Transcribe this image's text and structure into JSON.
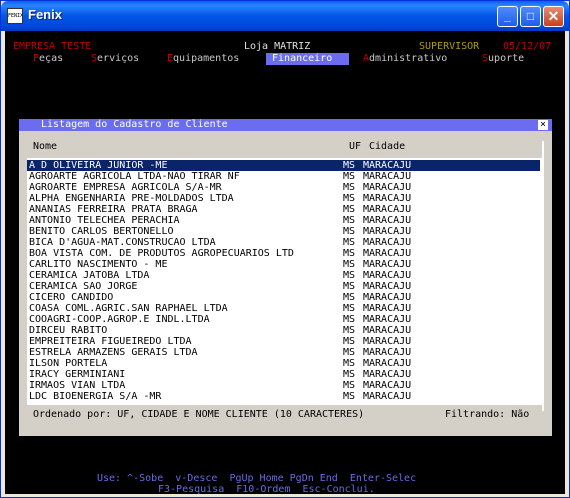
{
  "window": {
    "title": "Fenix",
    "icon_text": "FENIX",
    "btn_min": "_",
    "btn_max": "□",
    "btn_close": "✕"
  },
  "header": {
    "empresa": "EMPRESA TESTE",
    "loja": "Loja MATRIZ",
    "supervisor": "SUPERVISOR",
    "date": "05/12/07"
  },
  "menu": [
    {
      "hotkey": "P",
      "rest": "eças",
      "active": false
    },
    {
      "hotkey": "S",
      "rest": "erviços",
      "active": false
    },
    {
      "hotkey": "E",
      "rest": "quipamentos",
      "active": false
    },
    {
      "hotkey": "F",
      "rest": "inanceiro",
      "active": true
    },
    {
      "hotkey": "A",
      "rest": "dministrativo",
      "active": false
    },
    {
      "hotkey": "S",
      "rest": "uporte",
      "active": false
    }
  ],
  "dialog": {
    "title": "Listagem do Cadastro de Cliente",
    "close": "×",
    "columns": {
      "nome": "Nome",
      "uf": "UF",
      "cidade": "Cidade"
    },
    "rows": [
      {
        "nome": "A D OLIVEIRA JUNIOR -ME",
        "uf": "MS",
        "cidade": "MARACAJU",
        "selected": true
      },
      {
        "nome": "AGROARTE AGRICOLA LTDA-NÃO TIRAR NF",
        "uf": "MS",
        "cidade": "MARACAJU"
      },
      {
        "nome": "AGROARTE EMPRESA AGRICOLA S/A-MR",
        "uf": "MS",
        "cidade": "MARACAJU"
      },
      {
        "nome": "ALPHA ENGENHARIA PRE-MOLDADOS LTDA",
        "uf": "MS",
        "cidade": "MARACAJU"
      },
      {
        "nome": "ANANIAS FERREIRA PRATA BRAGA",
        "uf": "MS",
        "cidade": "MARACAJU"
      },
      {
        "nome": "ANTONIO TELECHEA PERACHIA",
        "uf": "MS",
        "cidade": "MARACAJU"
      },
      {
        "nome": "BENITO CARLOS BERTONELLO",
        "uf": "MS",
        "cidade": "MARACAJU"
      },
      {
        "nome": "BICA D'AGUA-MAT.CONSTRUCAO LTDA",
        "uf": "MS",
        "cidade": "MARACAJU"
      },
      {
        "nome": "BOA VISTA COM. DE PRODUTOS AGROPECUARIOS LTD",
        "uf": "MS",
        "cidade": "MARACAJU"
      },
      {
        "nome": "CARLITO NASCIMENTO - ME",
        "uf": "MS",
        "cidade": "MARACAJU"
      },
      {
        "nome": "CERAMICA JATOBA LTDA",
        "uf": "MS",
        "cidade": "MARACAJU"
      },
      {
        "nome": "CERAMICA SAO JORGE",
        "uf": "MS",
        "cidade": "MARACAJU"
      },
      {
        "nome": "CICERO CANDIDO",
        "uf": "MS",
        "cidade": "MARACAJU"
      },
      {
        "nome": "COASA COML.AGRIC.SAN RAPHAEL LTDA",
        "uf": "MS",
        "cidade": "MARACAJU"
      },
      {
        "nome": "COOAGRI-COOP.AGROP.E INDL.LTDA",
        "uf": "MS",
        "cidade": "MARACAJU"
      },
      {
        "nome": "DIRCEU RABITO",
        "uf": "MS",
        "cidade": "MARACAJU"
      },
      {
        "nome": "EMPREITEIRA FIGUEIREDO LTDA",
        "uf": "MS",
        "cidade": "MARACAJU"
      },
      {
        "nome": "ESTRELA ARMAZENS GERAIS LTDA",
        "uf": "MS",
        "cidade": "MARACAJU"
      },
      {
        "nome": "ILSON PORTELA",
        "uf": "MS",
        "cidade": "MARACAJU"
      },
      {
        "nome": "IRACY GERMINIANI",
        "uf": "MS",
        "cidade": "MARACAJU"
      },
      {
        "nome": "IRMAOS VIAN LTDA",
        "uf": "MS",
        "cidade": "MARACAJU"
      },
      {
        "nome": "LDC BIOENERGIA S/A -MR",
        "uf": "MS",
        "cidade": "MARACAJU"
      }
    ],
    "footer_left": "Ordenado por: UF, CIDADE E NOME CLIENTE (10 CARACTERES)",
    "footer_right": "Filtrando: Não"
  },
  "help": {
    "line1": "Use: ^-Sobe  v-Desce  PgUp Home PgDn End  Enter-Selec",
    "line2": "F3-Pesquisa  F10-Ordem  Esc-Conclui."
  },
  "colors": {
    "menu_active": "#6c6cf0",
    "hotkey": "#c00000",
    "selection": "#0a246a",
    "help": "#6a6ae8"
  }
}
